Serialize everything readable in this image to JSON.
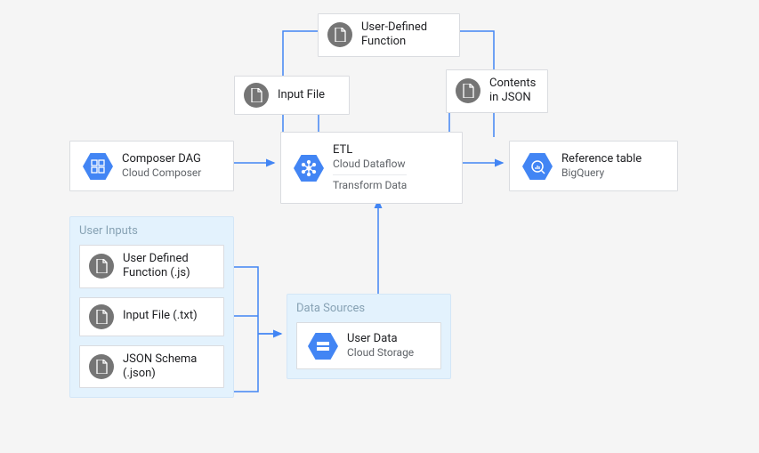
{
  "nodes": {
    "udf_top": {
      "title": "User-Defined Function"
    },
    "input_file": {
      "title": "Input File"
    },
    "contents_json": {
      "title": "Contents in JSON"
    },
    "composer": {
      "title": "Composer DAG",
      "subtitle": "Cloud Composer"
    },
    "etl": {
      "title": "ETL",
      "subtitle": "Cloud Dataflow",
      "subtitle2": "Transform Data"
    },
    "bigquery": {
      "title": "Reference table",
      "subtitle": "BigQuery"
    }
  },
  "groups": {
    "user_inputs": {
      "title": "User Inputs",
      "items": [
        {
          "title": "User Defined Function (.js)"
        },
        {
          "title": "Input File (.txt)"
        },
        {
          "title": "JSON Schema (.json)"
        }
      ]
    },
    "data_sources": {
      "title": "Data Sources",
      "items": [
        {
          "title": "User Data",
          "subtitle": "Cloud Storage"
        }
      ]
    }
  },
  "colors": {
    "blue": "#4285f4",
    "arrow": "#4285f4",
    "gray_icon": "#757575",
    "group_bg": "#e3f2fd"
  }
}
